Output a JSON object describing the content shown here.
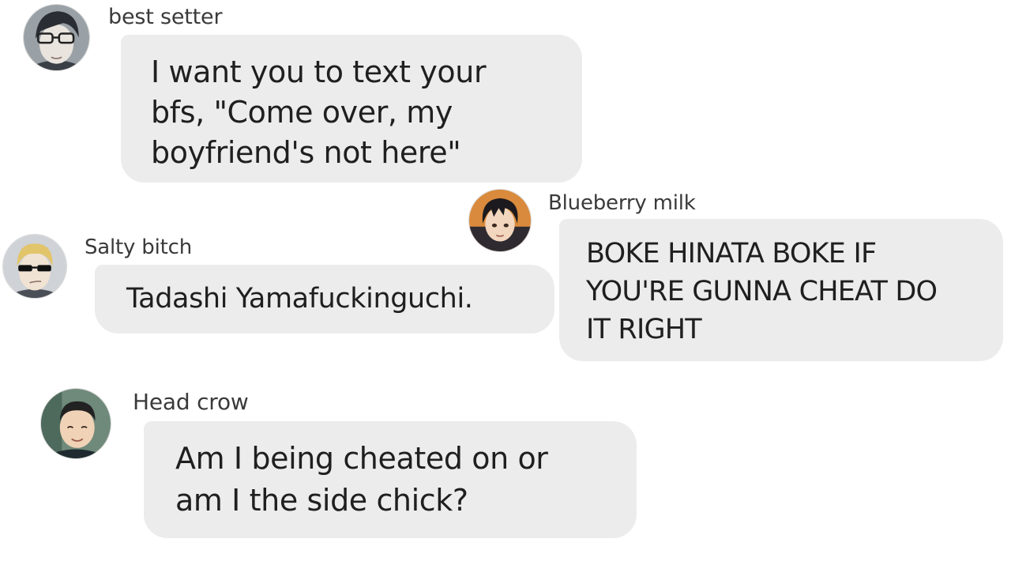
{
  "messages": [
    {
      "id": "m1",
      "sender": "best setter",
      "avatar_icon": "avatar-glasses-boy",
      "text": "I want you to text your\nbfs, \"Come over, my\nboyfriend's not here\""
    },
    {
      "id": "m2",
      "sender": "Blueberry milk",
      "avatar_icon": "avatar-dark-hair-boy",
      "text": "BOKE HINATA BOKE IF\nYOU'RE GUNNA CHEAT DO\nIT RIGHT"
    },
    {
      "id": "m3",
      "sender": "Salty bitch",
      "avatar_icon": "avatar-blond-sunglasses",
      "text": "Tadashi Yamafuckinguchi."
    },
    {
      "id": "m4",
      "sender": "Head crow",
      "avatar_icon": "avatar-buzzcut-boy",
      "text": "Am I being cheated on or\nam I the side chick?"
    }
  ],
  "colors": {
    "background": "#ffffff",
    "bubble": "#ececec",
    "text": "#1f1f1f",
    "sender": "#3a3a3a"
  }
}
